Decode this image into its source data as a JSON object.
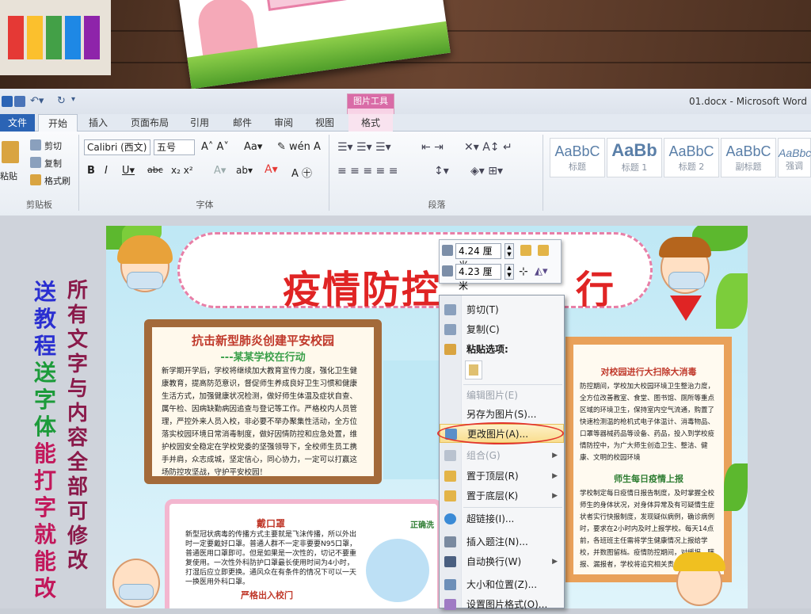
{
  "window": {
    "title": "01.docx - Microsoft Word"
  },
  "context_tab": {
    "group": "图片工具",
    "tab": "格式"
  },
  "tabs": [
    "文件",
    "开始",
    "插入",
    "页面布局",
    "引用",
    "邮件",
    "审阅",
    "视图"
  ],
  "clipboard": {
    "paste": "粘贴",
    "cut": "剪切",
    "copy": "复制",
    "format_painter": "格式刷",
    "group": "剪贴板"
  },
  "font": {
    "name": "Calibri (西文)",
    "size": "五号",
    "group": "字体"
  },
  "paragraph": {
    "group": "段落"
  },
  "styles": [
    {
      "sample": "AaBbC",
      "name": "标题"
    },
    {
      "sample": "AaBb",
      "name": "标题 1"
    },
    {
      "sample": "AaBbC",
      "name": "标题 2"
    },
    {
      "sample": "AaBbC",
      "name": "副标题"
    },
    {
      "sample": "AaBbc",
      "name": "强调"
    }
  ],
  "side_text": {
    "left": [
      "送",
      "教",
      "程",
      "送",
      "字",
      "体",
      "能",
      "打",
      "字",
      "就",
      "能",
      "改"
    ],
    "right": "所有文字与内容全部可修改"
  },
  "poster": {
    "title_part1": "疫情防控",
    "title_part2": "行",
    "board_title": "抗击新型肺炎创建平安校园",
    "board_sub": "---某某学校在行动",
    "board_body": "新学期开学后，学校将继续加大教育宣传力度，强化卫生健康教育，提高防范意识，督促师生养成良好卫生习惯和健康生活方式，加强健康状况检测，做好师生体温及症状自查、属午检、因病缺勤病因追查与登记等工作。严格校内人员管理，严控外来人员入校，非必要不举办聚集性活动，全方位落实校园环境日常消毒制度，做好因情防控和应急处置，维护校园安全稳定在学校党委的坚强领导下，全校师生员工携手并肩，众志成城，坚定信心，同心协力，一定可以打赢这场防控攻坚战，守护平安校园！",
    "note_title": "戴口罩",
    "note_body": "新型冠状病毒的传播方式主要就是飞沫传播，所以外出时一定要戴好口罩。普通人群不一定非要要N95口罩，普通医用口罩即可。但是如果是一次性的，切记不要重复使用。一次性外科防护口罩最长使用时间为4小时，打湿后应立即更换。通风众在有条件的情况下可以一天一换医用外科口罩。",
    "note_title2": "严格出入校门",
    "note_right_title": "正确洗",
    "r_title1": "对校园进行大扫除大消毒",
    "r_body1": "防控期间，学校加大校园环境卫生整治力度，全方位改善教室、食堂、图书馆、厕所等重点区域的环境卫生，保持室内空气流通，购置了快速检测温的枪机式电子体温计、消毒物品、口罩等器械药品等设备、药品，投入到学校疫情防控中，为广大师生创造卫生、整洁、健康、文明的校园环境",
    "r_title2": "师生每日疫情上报",
    "r_body2": "学校制定每日疫情日报告制度，及时掌握全校师生的身体状况，对身体异常及有可疑情生症状者实行快报制度，发现疑似病例，确诊病例时，要求在2小时内及时上报学校。每天14点前，各班班主任需将学生健康情况上报给学校，并数图留档。疫情防控期间，对缓报、瞒报、漏报者，学校将追究相关责任。"
  },
  "size_toolbar": {
    "height": "4.24 厘米",
    "width": "4.23 厘米"
  },
  "context_menu": {
    "items": [
      {
        "label": "剪切(T)",
        "disabled": false
      },
      {
        "label": "复制(C)",
        "disabled": false
      },
      {
        "label": "粘贴选项:",
        "disabled": false
      },
      {
        "label": "编辑图片(E)",
        "disabled": true
      },
      {
        "label": "另存为图片(S)...",
        "disabled": false
      },
      {
        "label": "更改图片(A)...",
        "disabled": false
      },
      {
        "label": "组合(G)",
        "disabled": true
      },
      {
        "label": "置于顶层(R)",
        "disabled": false
      },
      {
        "label": "置于底层(K)",
        "disabled": false
      },
      {
        "label": "超链接(I)...",
        "disabled": false
      },
      {
        "label": "插入题注(N)...",
        "disabled": false
      },
      {
        "label": "自动换行(W)",
        "disabled": false
      },
      {
        "label": "大小和位置(Z)...",
        "disabled": false
      },
      {
        "label": "设置图片格式(O)...",
        "disabled": false
      }
    ]
  },
  "colors": {
    "file_tab": "#2b64b5",
    "highlight_ring": "#e2342c",
    "ctx_tab": "#d96ca7"
  }
}
